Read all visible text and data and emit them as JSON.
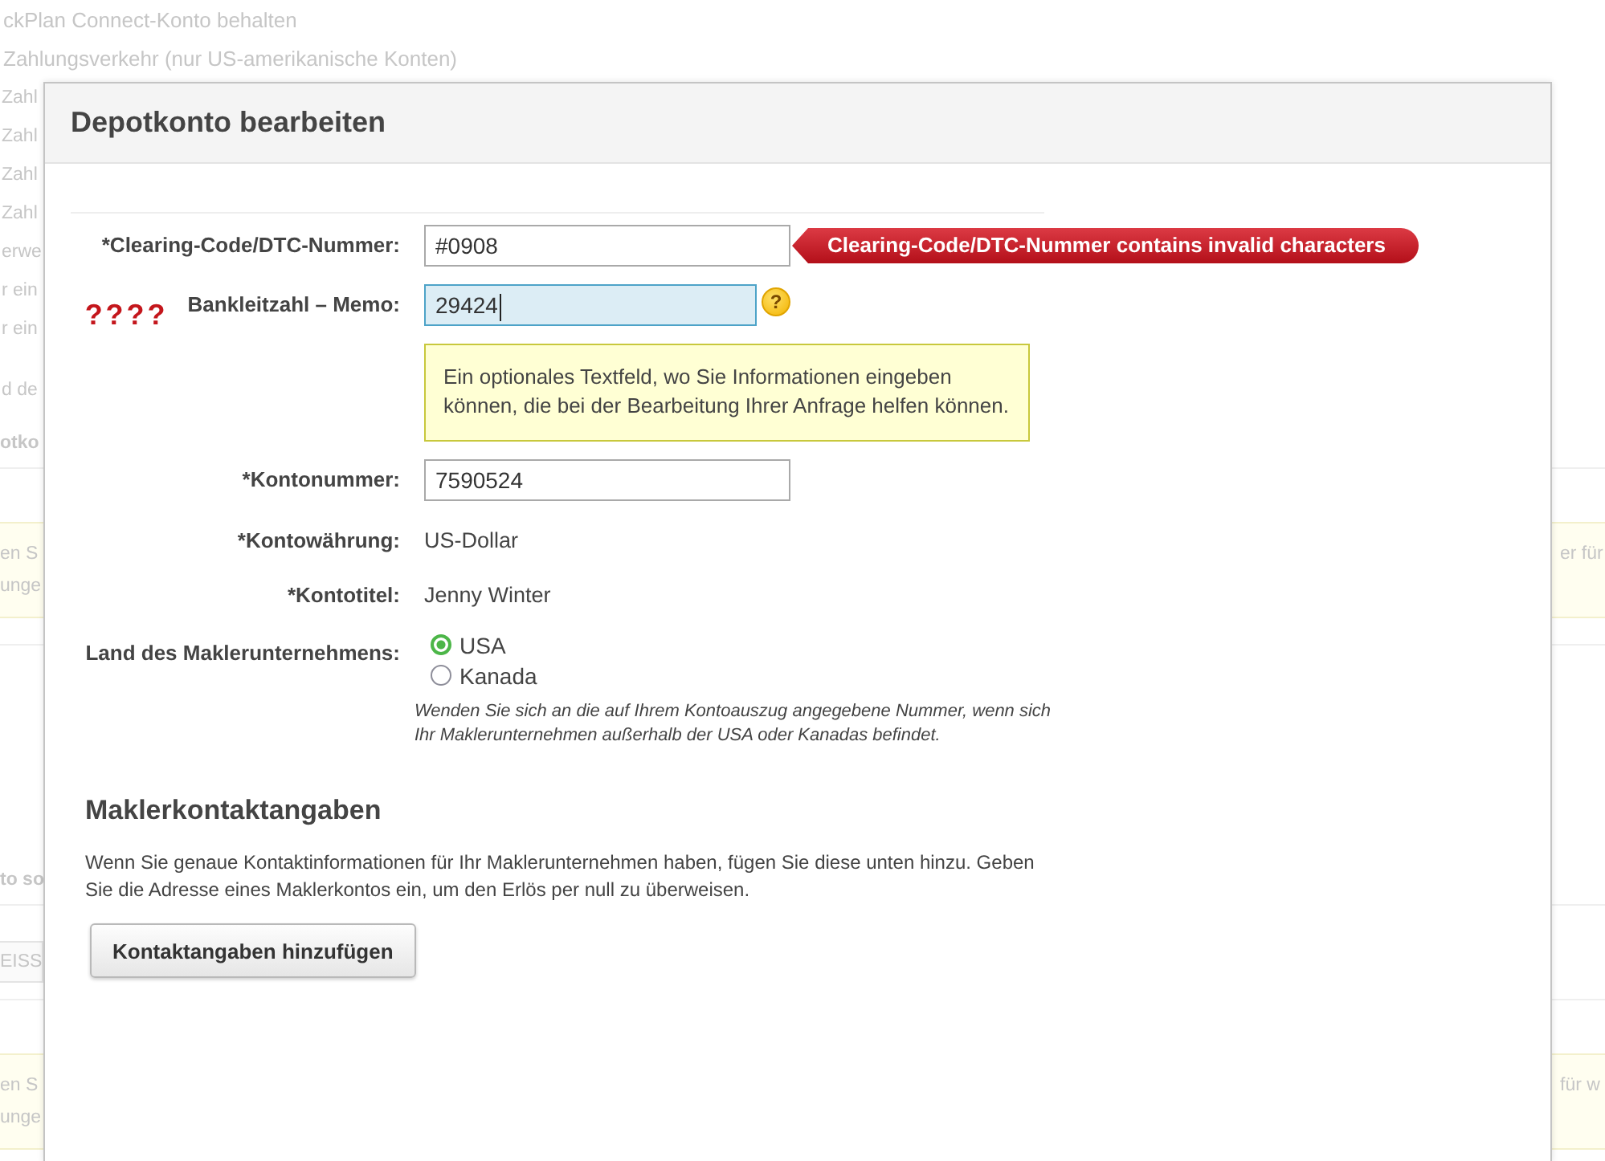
{
  "background_page": {
    "lines": [
      "ckPlan Connect-Konto behalten",
      "Zahlungsverkehr (nur US-amerikanische Konten)"
    ],
    "rows": [
      {
        "kind": "lines",
        "left": [
          "Zahl",
          "Zahl",
          "Zahl",
          "Zahl",
          "erwe",
          "r ein",
          "r ein"
        ]
      },
      {
        "kind": "lines",
        "left": [
          "d de"
        ]
      },
      {
        "kind": "heading",
        "left": [
          "otko"
        ]
      },
      {
        "kind": "notice",
        "left": [
          "en S",
          "unge"
        ],
        "right": [
          "er für"
        ]
      },
      {
        "kind": "heading",
        "left": [
          "to so"
        ]
      },
      {
        "kind": "field",
        "left": [
          "EISS"
        ]
      },
      {
        "kind": "notice",
        "left": [
          "en S",
          "unge"
        ],
        "right": [
          "für w"
        ]
      }
    ]
  },
  "dialog": {
    "title": "Depotkonto bearbeiten",
    "fields": [
      {
        "kind": "input",
        "label": "*Clearing-Code/DTC-Nummer:",
        "value": "#0908",
        "focused": false,
        "error": "Clearing-Code/DTC-Nummer contains invalid characters"
      },
      {
        "kind": "input",
        "label": "Bankleitzahl – Memo:",
        "marker": "????",
        "value": "29424",
        "focused": true,
        "help": {
          "icon": "?",
          "text": "Ein optionales Textfeld, wo Sie Informationen eingeben können, die bei der Bearbeitung Ihrer Anfrage helfen können."
        }
      },
      {
        "kind": "input",
        "label": "*Kontonummer:",
        "value": "7590524",
        "focused": false
      },
      {
        "kind": "static",
        "label": "*Kontowährung:",
        "value": "US-Dollar"
      },
      {
        "kind": "static",
        "label": "*Kontotitel:",
        "value": "Jenny Winter"
      },
      {
        "kind": "radio",
        "label": "Land des Maklerunternehmens:",
        "options": [
          {
            "label": "USA",
            "selected": true
          },
          {
            "label": "Kanada",
            "selected": false
          }
        ],
        "note": "Wenden Sie sich an die auf Ihrem Kontoauszug angegebene Nummer, wenn sich Ihr Maklerunternehmen außerhalb der USA oder Kanadas befindet."
      }
    ],
    "contact_section": {
      "heading": "Maklerkontaktangaben",
      "text": "Wenn Sie genaue Kontaktinformationen für Ihr Maklerunternehmen haben, fügen Sie diese unten hinzu. Geben Sie die Adresse eines Maklerkontos ein, um den Erlös per null zu überweisen.",
      "button": "Kontaktangaben hinzufügen"
    }
  }
}
